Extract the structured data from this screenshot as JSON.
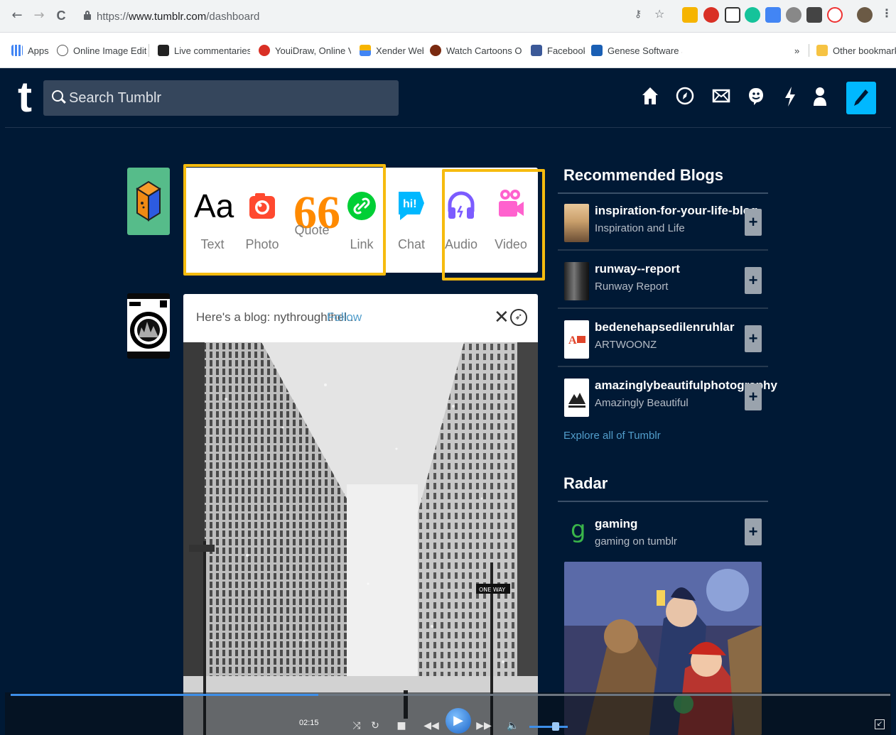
{
  "browser": {
    "url_scheme": "https://",
    "url_host": "www.tumblr.com",
    "url_path": "/dashboard",
    "nav": {
      "back": "←",
      "forward": "→",
      "reload": "C"
    },
    "bookmarks": [
      {
        "label": "Apps"
      },
      {
        "label": "Online Image Editor"
      },
      {
        "label": "Live commentaries o"
      },
      {
        "label": "YouiDraw, Online Ve"
      },
      {
        "label": "Xender Web"
      },
      {
        "label": "Watch Cartoons Onli"
      },
      {
        "label": "Facebook"
      },
      {
        "label": "Genese Software Sol"
      }
    ],
    "overflow_label": "»",
    "other_bookmarks": "Other bookmarks"
  },
  "tumblr": {
    "logo": "t",
    "search_placeholder": "Search Tumblr",
    "post_types": [
      {
        "label": "Text",
        "icon": "Aa",
        "color": "#000000"
      },
      {
        "label": "Photo",
        "icon": "camera",
        "color": "#ff492f"
      },
      {
        "label": "Quote",
        "icon": "66",
        "color": "#ff8a00"
      },
      {
        "label": "Link",
        "icon": "link",
        "color": "#00cf35"
      },
      {
        "label": "Chat",
        "icon": "hi!",
        "color": "#00b8ff"
      },
      {
        "label": "Audio",
        "icon": "headphones",
        "color": "#7c5cff"
      },
      {
        "label": "Video",
        "icon": "video-camera",
        "color": "#ff62ce"
      }
    ],
    "feed": {
      "intro": "Here's a blog: nythroughthel...",
      "follow": "Follow"
    },
    "recommended_title": "Recommended Blogs",
    "recommended": [
      {
        "name": "inspiration-for-your-life-blog",
        "subtitle": "Inspiration and Life"
      },
      {
        "name": "runway--report",
        "subtitle": "Runway Report"
      },
      {
        "name": "bedenehapsedilenruhlar",
        "subtitle": "ARTWOONZ"
      },
      {
        "name": "amazinglybeautifulphotography",
        "subtitle": "Amazingly Beautiful"
      }
    ],
    "explore": "Explore all of Tumblr",
    "radar_title": "Radar",
    "radar": {
      "name": "gaming",
      "subtitle": "gaming on tumblr",
      "badge": "g"
    },
    "plus_label": "+"
  },
  "player": {
    "time": "02:15",
    "progress": 0.35
  }
}
